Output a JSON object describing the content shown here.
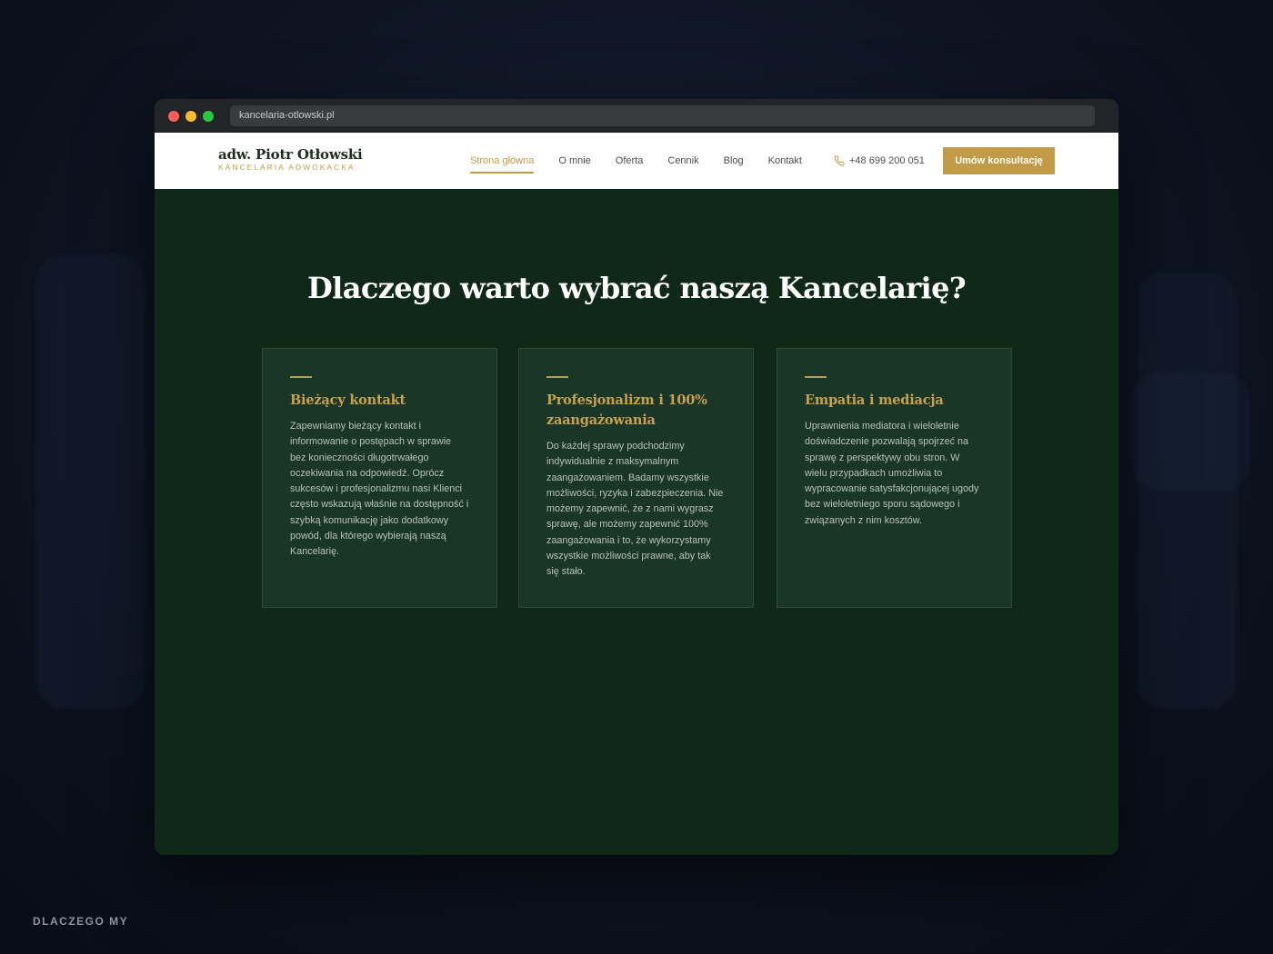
{
  "browser": {
    "url": "kancelaria-otlowski.pl"
  },
  "header": {
    "logo_name": "adw. Piotr Otłowski",
    "logo_subtitle": "KANCELARIA ADWOKACKA",
    "nav": [
      {
        "label": "Strona główna",
        "active": true
      },
      {
        "label": "O mnie",
        "active": false
      },
      {
        "label": "Oferta",
        "active": false
      },
      {
        "label": "Cennik",
        "active": false
      },
      {
        "label": "Blog",
        "active": false
      },
      {
        "label": "Kontakt",
        "active": false
      }
    ],
    "phone": "+48 699 200 051",
    "cta_label": "Umów konsultację"
  },
  "section": {
    "title": "Dlaczego warto wybrać naszą Kancelarię?",
    "cards": [
      {
        "title": "Bieżący kontakt",
        "text": "Zapewniamy bieżący kontakt i informowanie o postępach w sprawie bez konieczności długotrwałego oczekiwania na odpowiedź. Oprócz sukcesów i profesjonalizmu nasi Klienci często wskazują właśnie na dostępność i szybką komunikację jako dodatkowy powód, dla którego wybierają naszą Kancelarię."
      },
      {
        "title": "Profesjonalizm i 100% zaangażowania",
        "text": "Do każdej sprawy podchodzimy indywidualnie z maksymalnym zaangażowaniem. Badamy wszystkie możliwości, ryzyka i zabezpieczenia. Nie możemy zapewnić, że z nami wygrasz sprawę, ale możemy zapewnić 100% zaangażowania i to, że wykorzystamy wszystkie możliwości prawne, aby tak się stało."
      },
      {
        "title": "Empatia i mediacja",
        "text": "Uprawnienia mediatora i wieloletnie doświadczenie pozwalają spojrzeć na sprawę z perspektywy obu stron. W wielu przypadkach umożliwia to wypracowanie satysfakcjonującej ugody bez wieloletniego sporu sądowego i związanych z nim kosztów."
      }
    ]
  },
  "footer_label": "DLACZEGO MY",
  "colors": {
    "accent_gold": "#c29b48",
    "section_bg": "#0f2818",
    "card_bg": "#1a3626"
  }
}
